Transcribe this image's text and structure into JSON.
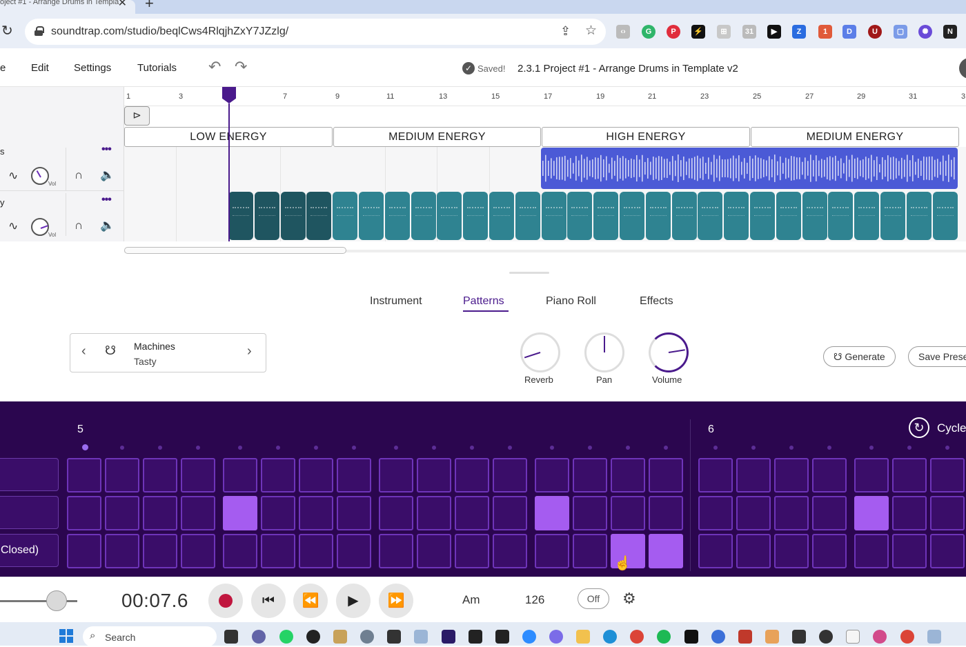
{
  "browser": {
    "tab_title": "oject #1 - Arrange Drums in Templa",
    "url": "soundtrap.com/studio/beqlCws4RlqjhZxY7JZzlg/"
  },
  "app": {
    "menu": [
      "e",
      "Edit",
      "Settings",
      "Tutorials"
    ],
    "saved_text": "Saved!",
    "project_title": "2.3.1 Project #1 - Arrange Drums in Template v2"
  },
  "timeline": {
    "ruler": [
      "1",
      "3",
      "5",
      "7",
      "9",
      "11",
      "13",
      "15",
      "17",
      "19",
      "21",
      "23",
      "25",
      "27",
      "29",
      "31",
      "3"
    ],
    "sections": [
      "LOW ENERGY",
      "MEDIUM ENERGY",
      "HIGH ENERGY",
      "MEDIUM ENERGY"
    ],
    "tracks": [
      {
        "name": "s",
        "vol_label": "Vol"
      },
      {
        "name": "y",
        "vol_label": "Vol"
      }
    ]
  },
  "editor": {
    "tabs": [
      "Instrument",
      "Patterns",
      "Piano Roll",
      "Effects"
    ],
    "active_tab": "Patterns",
    "preset": {
      "name": "Machines",
      "sub": "Tasty"
    },
    "knobs": [
      {
        "label": "Reverb",
        "level": 0.1
      },
      {
        "label": "Pan",
        "level": 0.5
      },
      {
        "label": "Volume",
        "level": 0.8
      }
    ],
    "generate_label": "Generate",
    "save_preset_label": "Save Prese"
  },
  "sequencer": {
    "bars": [
      "5",
      "6"
    ],
    "cycle_label": "Cycle",
    "rows": [
      {
        "label": "",
        "on": []
      },
      {
        "label": "",
        "on": [
          4,
          12,
          20
        ]
      },
      {
        "label": "Closed)",
        "on": [
          14,
          15
        ]
      }
    ],
    "steps_visible": 23,
    "active_beat": 0
  },
  "transport": {
    "time": "00:07.6",
    "key": "Am",
    "bpm": "126",
    "metronome": "Off",
    "zoom_level": 0.7
  },
  "taskbar": {
    "search_label": "Search"
  }
}
